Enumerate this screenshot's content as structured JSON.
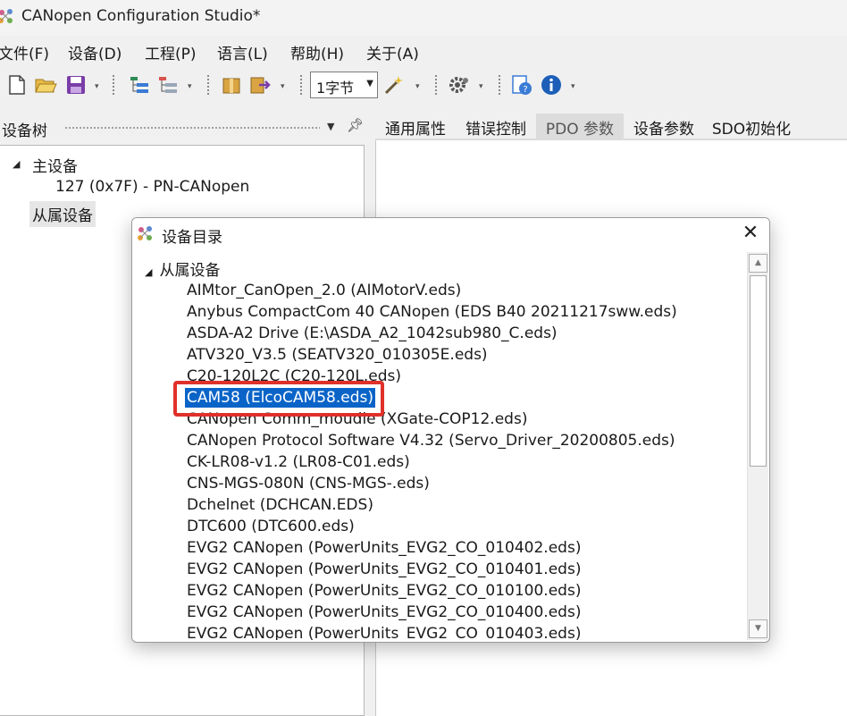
{
  "window": {
    "title": "CANopen Configuration Studio*"
  },
  "menu": [
    "文件(F)",
    "设备(D)",
    "工程(P)",
    "语言(L)",
    "帮助(H)",
    "关于(A)"
  ],
  "toolbar": {
    "byte_combo_value": "1字节"
  },
  "left_panel": {
    "title": "设备树",
    "tree": {
      "master_label": "主设备",
      "master_child": "127 (0x7F)  -  PN-CANopen",
      "slave_label": "从属设备"
    }
  },
  "tabs": [
    "通用属性",
    "错误控制",
    "PDO 参数",
    "设备参数",
    "SDO初始化"
  ],
  "active_tab": "PDO 参数",
  "dialog": {
    "title": "设备目录",
    "group_label": "从属设备",
    "close_glyph": "✕",
    "items": [
      "AIMtor_CanOpen_2.0 (AIMotorV.eds)",
      "Anybus CompactCom 40 CANopen (EDS B40 20211217sww.eds)",
      "ASDA-A2 Drive (E:\\ASDA_A2_1042sub980_C.eds)",
      "ATV320_V3.5 (SEATV320_010305E.eds)",
      "C20-120L2C (C20-120L.eds)",
      "CAM58 (ElcoCAM58.eds)",
      "CANopen Comm_moudle (XGate-COP12.eds)",
      "CANopen Protocol Software V4.32 (Servo_Driver_20200805.eds)",
      "CK-LR08-v1.2 (LR08-C01.eds)",
      "CNS-MGS-080N (CNS-MGS-.eds)",
      "Dchelnet (DCHCAN.EDS)",
      "DTC600 (DTC600.eds)",
      "EVG2 CANopen (PowerUnits_EVG2_CO_010402.eds)",
      "EVG2 CANopen (PowerUnits_EVG2_CO_010401.eds)",
      "EVG2 CANopen (PowerUnits_EVG2_CO_010100.eds)",
      "EVG2 CANopen (PowerUnits_EVG2_CO_010400.eds)",
      "EVG2 CANopen (PowerUnits_EVG2_CO_010403.eds)"
    ],
    "selected_item": "CAM58 (ElcoCAM58.eds)"
  },
  "colors": {
    "selection": "#0a64c8",
    "annotation_box": "#e0302a",
    "active_tab_bg": "#dcdcdc"
  }
}
